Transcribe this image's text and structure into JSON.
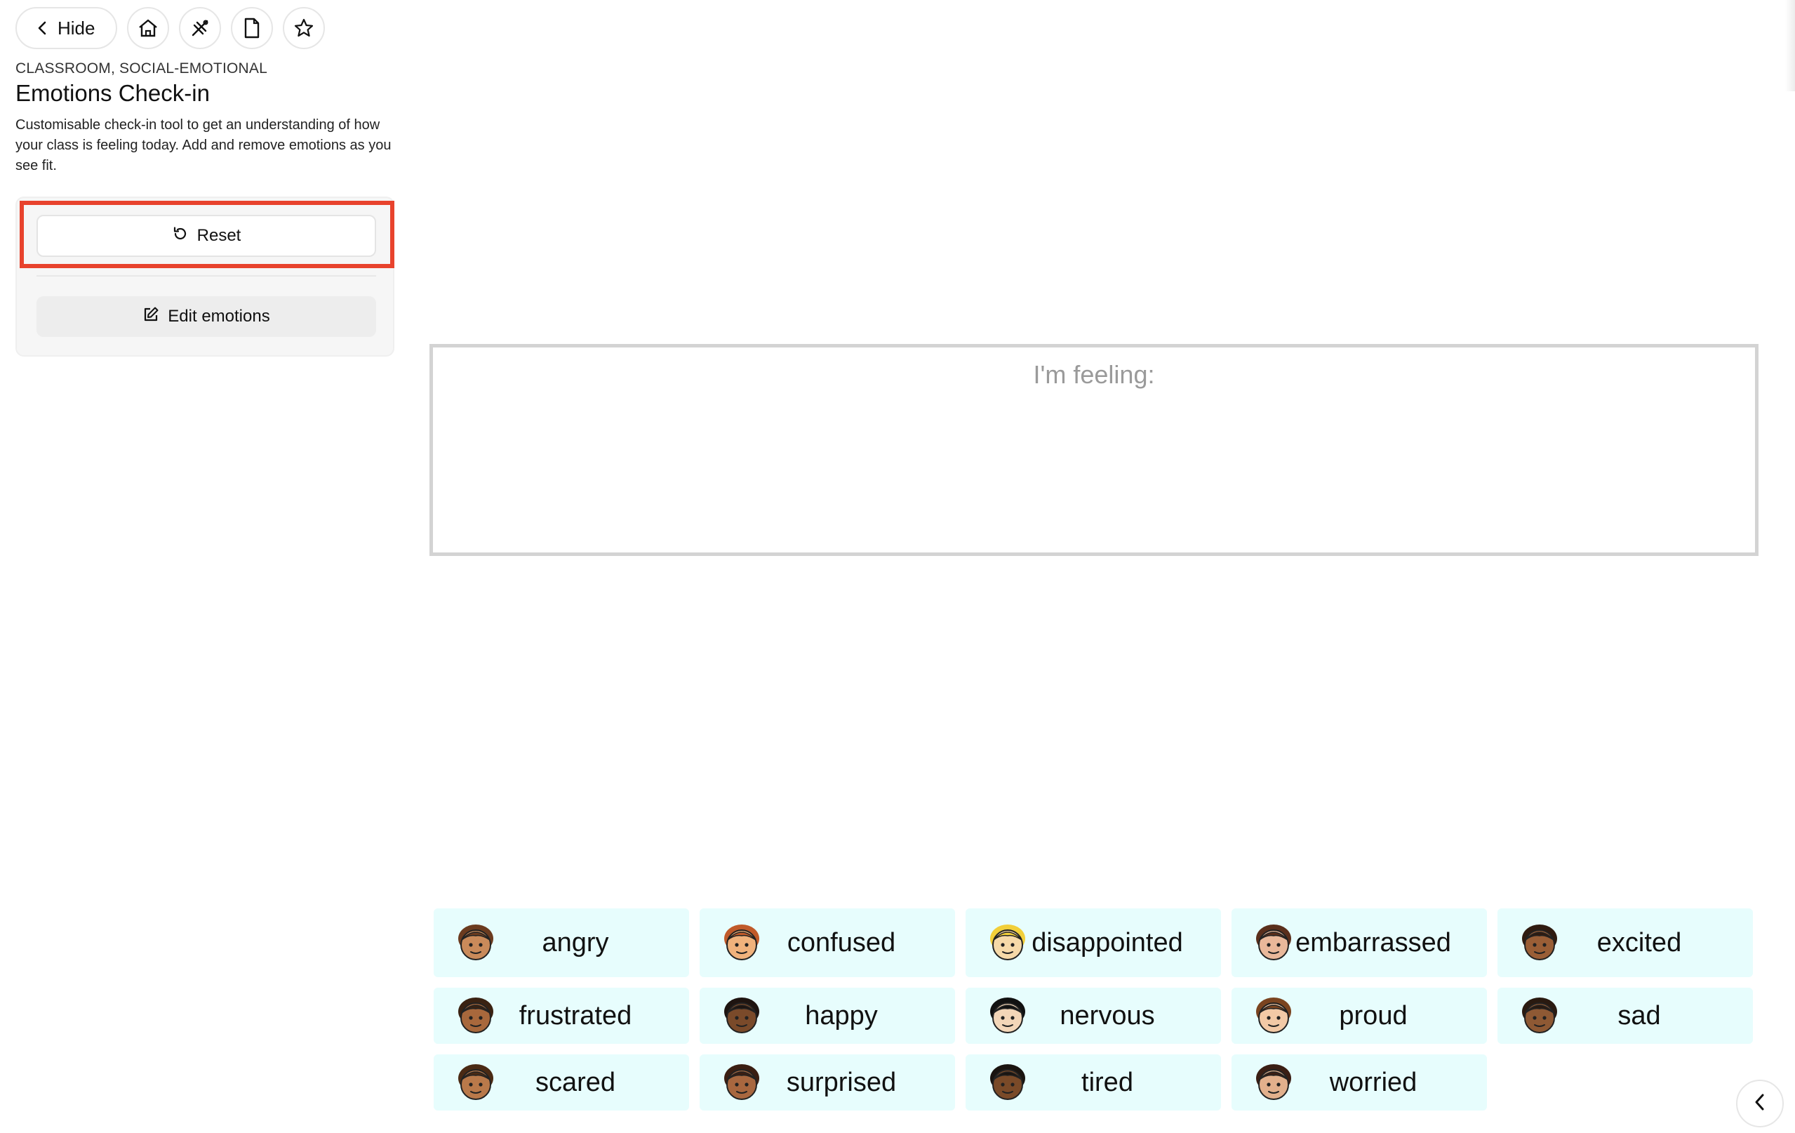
{
  "toolbar": {
    "hide_label": "Hide",
    "icons": [
      "chevron-left-icon",
      "home-icon",
      "share-icon",
      "document-icon",
      "star-icon"
    ]
  },
  "sidebar": {
    "category": "CLASSROOM, SOCIAL-EMOTIONAL",
    "title": "Emotions Check-in",
    "description": "Customisable check-in tool to get an understanding of how your class is feeling today. Add and remove emotions as you see fit.",
    "reset_label": "Reset",
    "edit_label": "Edit emotions"
  },
  "main": {
    "feeling_label": "I'm feeling:",
    "emotions": [
      {
        "label": "angry",
        "icon": "angry-face-icon",
        "skin": "#c98a5a",
        "hair": "#6b3b1f"
      },
      {
        "label": "confused",
        "icon": "confused-face-icon",
        "skin": "#f0b27c",
        "hair": "#c05a2a"
      },
      {
        "label": "disappointed",
        "icon": "disappointed-face-icon",
        "skin": "#f6d9a8",
        "hair": "#f2cf3a"
      },
      {
        "label": "embarrassed",
        "icon": "embarrassed-face-icon",
        "skin": "#e9b89a",
        "hair": "#5a2f1c"
      },
      {
        "label": "excited",
        "icon": "excited-face-icon",
        "skin": "#9a5e36",
        "hair": "#2f1b10"
      },
      {
        "label": "frustrated",
        "icon": "frustrated-face-icon",
        "skin": "#a8683c",
        "hair": "#3a2212"
      },
      {
        "label": "happy",
        "icon": "happy-face-icon",
        "skin": "#7a4a2a",
        "hair": "#1e1410"
      },
      {
        "label": "nervous",
        "icon": "nervous-face-icon",
        "skin": "#f3d6b8",
        "hair": "#111111"
      },
      {
        "label": "proud",
        "icon": "proud-face-icon",
        "skin": "#f2c9a6",
        "hair": "#7a4420"
      },
      {
        "label": "sad",
        "icon": "sad-face-icon",
        "skin": "#8e5934",
        "hair": "#2a1a10"
      },
      {
        "label": "scared",
        "icon": "scared-face-icon",
        "skin": "#b9794a",
        "hair": "#4a2a14"
      },
      {
        "label": "surprised",
        "icon": "surprised-face-icon",
        "skin": "#a8673f",
        "hair": "#3a1e12"
      },
      {
        "label": "tired",
        "icon": "tired-face-icon",
        "skin": "#7a4a28",
        "hair": "#1a1410"
      },
      {
        "label": "worried",
        "icon": "worried-face-icon",
        "skin": "#e2b08c",
        "hair": "#3a1e14"
      }
    ]
  },
  "colors": {
    "highlight": "#e8432d",
    "chip_bg": "#e7fdfd",
    "box_border": "#d3d3d3"
  }
}
